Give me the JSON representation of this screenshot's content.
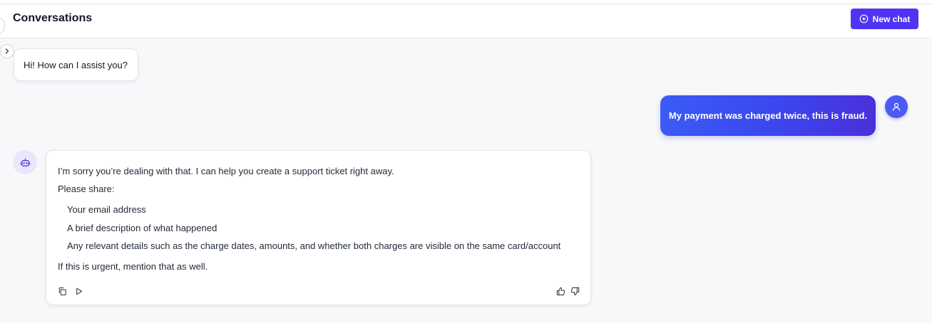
{
  "header": {
    "title": "Conversations",
    "new_chat_label": "New chat"
  },
  "messages": {
    "greeting": "Hi! How can I assist you?",
    "user": "My payment was charged twice, this is fraud.",
    "bot": {
      "intro": "I’m sorry you’re dealing with that. I can help you create a support ticket right away.",
      "prompt": "Please share:",
      "items": [
        "Your email address",
        "A brief description of what happened",
        "Any relevant details such as the charge dates, amounts, and whether both charges are visible on the same card/account"
      ],
      "closing": "If this is urgent, mention that as well."
    }
  },
  "icons": {
    "new_chat": "plus-circle-icon",
    "sidebar_toggle": "chevron-right-icon",
    "user_avatar": "user-icon",
    "bot_avatar": "robot-icon",
    "copy": "copy-icon",
    "play": "play-icon",
    "thumbs_up": "thumbs-up-icon",
    "thumbs_down": "thumbs-down-icon"
  },
  "colors": {
    "accent": "#4f35f3",
    "user_bubble_start": "#3b5cf6",
    "user_bubble_end": "#4b2fd9",
    "background": "#f7f8fa"
  }
}
